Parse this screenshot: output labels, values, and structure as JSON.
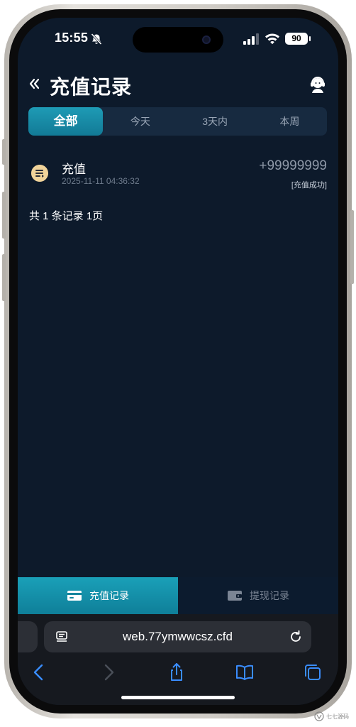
{
  "status_bar": {
    "time": "15:55",
    "battery": "90"
  },
  "header": {
    "title": "充值记录"
  },
  "filter_tabs": [
    {
      "label": "全部",
      "active": true
    },
    {
      "label": "今天",
      "active": false
    },
    {
      "label": "3天内",
      "active": false
    },
    {
      "label": "本周",
      "active": false
    }
  ],
  "records": [
    {
      "type": "充值",
      "time": "2025-11-11 04:36:32",
      "amount": "+99999999",
      "status": "[充值成功]"
    }
  ],
  "summary": "共 1 条记录 1页",
  "bottom_tabs": [
    {
      "label": "充值记录",
      "icon": "card-icon",
      "active": true
    },
    {
      "label": "提现记录",
      "icon": "wallet-icon",
      "active": false
    }
  ],
  "browser": {
    "url": "web.77ymwwcsz.cfd"
  },
  "watermark": {
    "text": "七七源码"
  },
  "colors": {
    "background": "#0d1a2b",
    "accent": "#1a9ab4",
    "amount": "#8f99a8",
    "record_icon": "#f0d39a"
  }
}
